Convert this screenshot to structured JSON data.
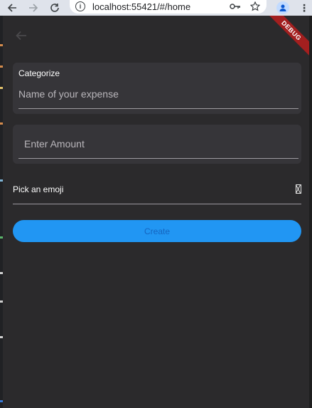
{
  "browser": {
    "url": "localhost:55421/#/home"
  },
  "app": {
    "debug_banner": "DEBUG",
    "category_field": {
      "label": "Categorize",
      "placeholder": "Name of your expense"
    },
    "amount_field": {
      "placeholder": "Enter Amount"
    },
    "emoji_picker": {
      "label": "Pick an emoji"
    },
    "create_button": {
      "label": "Create"
    }
  },
  "colors": {
    "background": "#2b2a2c",
    "field_fill": "#363539",
    "primary": "#2196f3",
    "button_text": "#1565c0",
    "debug_banner": "#a31f1f"
  }
}
